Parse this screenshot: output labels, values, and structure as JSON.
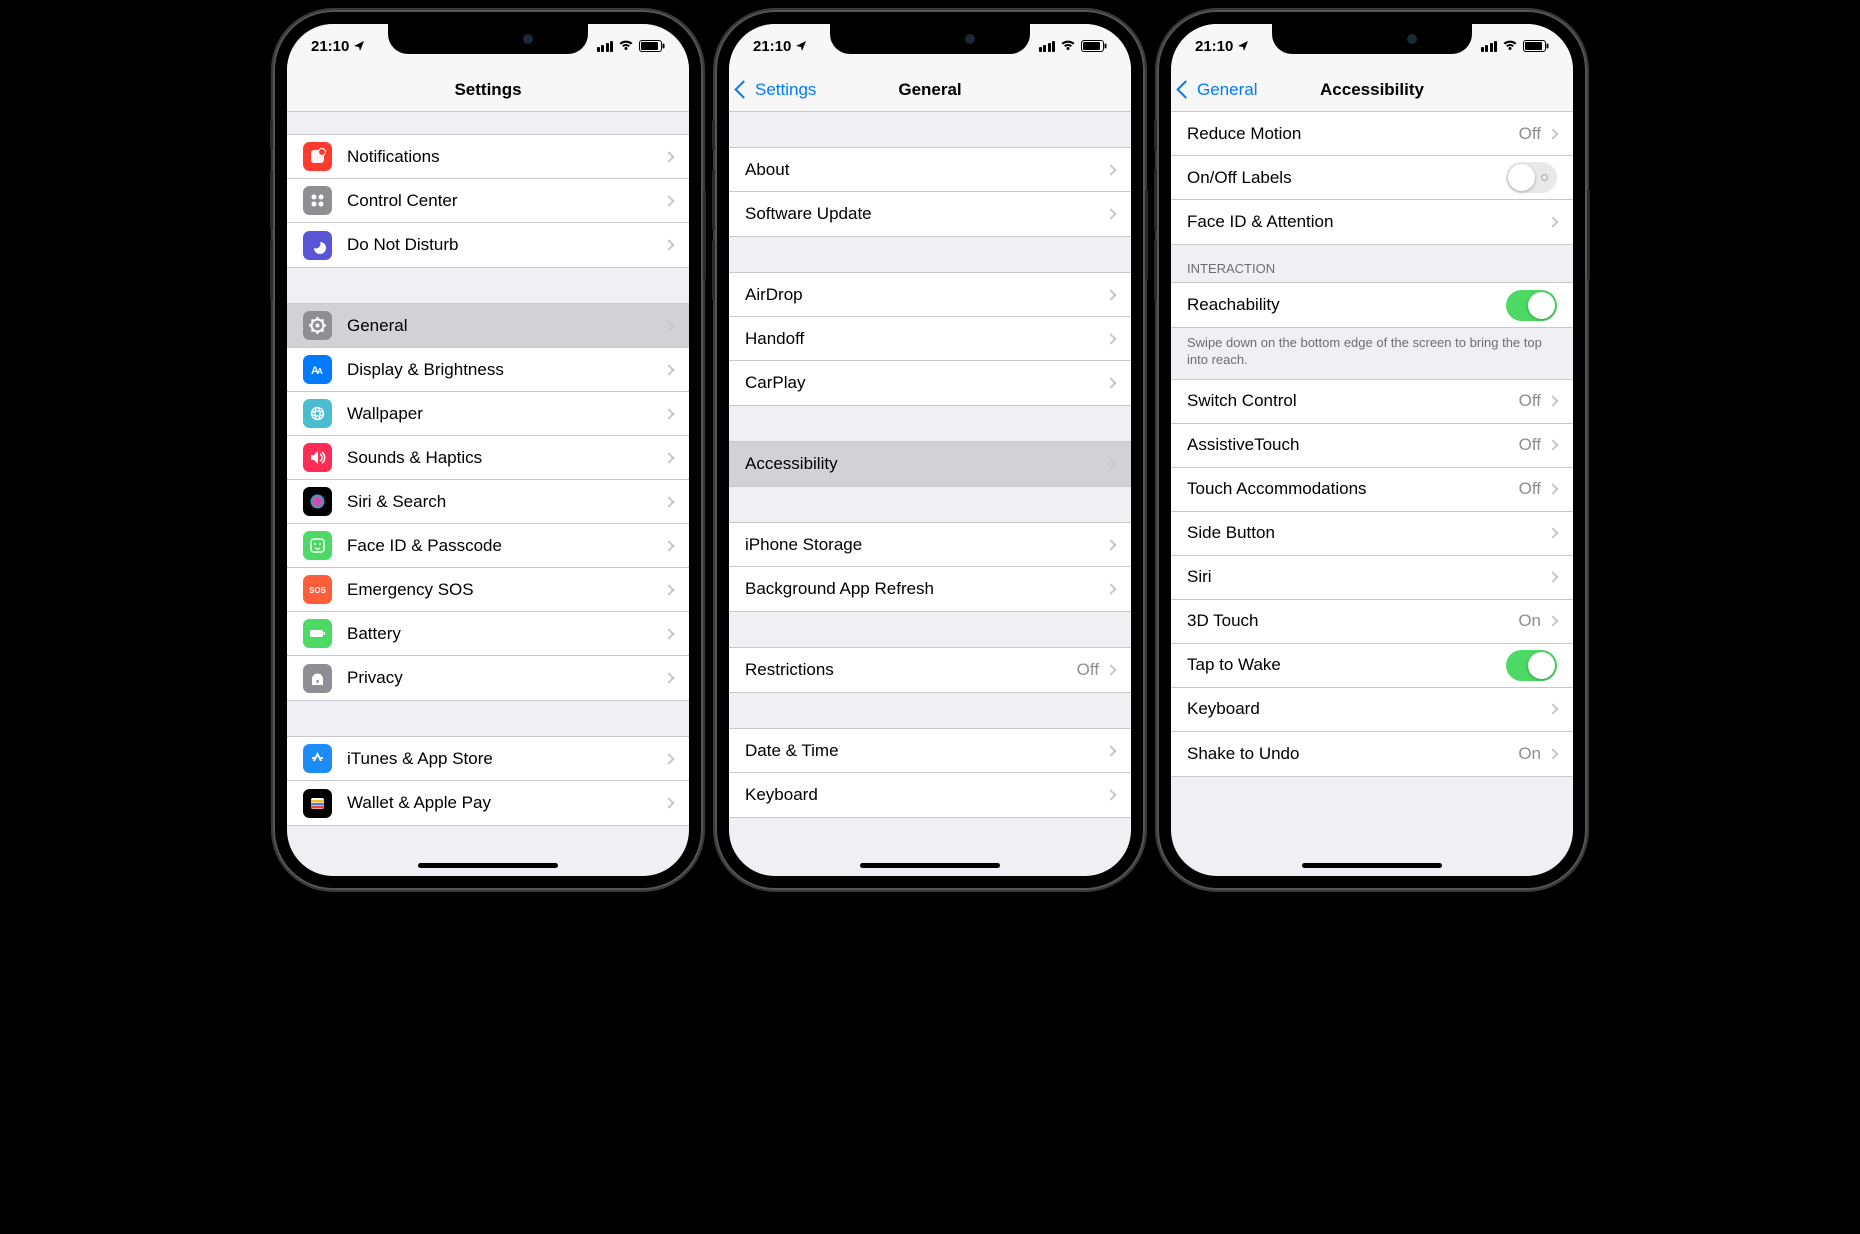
{
  "status": {
    "time": "21:10"
  },
  "phone1": {
    "title": "Settings",
    "items": [
      {
        "label": "Notifications",
        "icon": "notifications",
        "bg": "#ff3b30"
      },
      {
        "label": "Control Center",
        "icon": "control-center",
        "bg": "#8e8e93"
      },
      {
        "label": "Do Not Disturb",
        "icon": "dnd",
        "bg": "#5856d6"
      }
    ],
    "items2": [
      {
        "label": "General",
        "icon": "general",
        "bg": "#8e8e93",
        "selected": true
      },
      {
        "label": "Display & Brightness",
        "icon": "display",
        "bg": "#007aff"
      },
      {
        "label": "Wallpaper",
        "icon": "wallpaper",
        "bg": "#4bbdd1"
      },
      {
        "label": "Sounds & Haptics",
        "icon": "sounds",
        "bg": "#ff2d55"
      },
      {
        "label": "Siri & Search",
        "icon": "siri",
        "bg": "#000"
      },
      {
        "label": "Face ID & Passcode",
        "icon": "faceid",
        "bg": "#4cd964"
      },
      {
        "label": "Emergency SOS",
        "icon": "sos",
        "bg": "#ff5e3a"
      },
      {
        "label": "Battery",
        "icon": "battery",
        "bg": "#4cd964"
      },
      {
        "label": "Privacy",
        "icon": "privacy",
        "bg": "#8e8e93"
      }
    ],
    "items3": [
      {
        "label": "iTunes & App Store",
        "icon": "appstore",
        "bg": "#1e8cf7"
      },
      {
        "label": "Wallet & Apple Pay",
        "icon": "wallet",
        "bg": "#000"
      }
    ]
  },
  "phone2": {
    "back": "Settings",
    "title": "General",
    "g1": [
      {
        "label": "About"
      },
      {
        "label": "Software Update"
      }
    ],
    "g2": [
      {
        "label": "AirDrop"
      },
      {
        "label": "Handoff"
      },
      {
        "label": "CarPlay"
      }
    ],
    "g3": [
      {
        "label": "Accessibility",
        "selected": true
      }
    ],
    "g4": [
      {
        "label": "iPhone Storage"
      },
      {
        "label": "Background App Refresh"
      }
    ],
    "g5": [
      {
        "label": "Restrictions",
        "value": "Off"
      }
    ],
    "g6": [
      {
        "label": "Date & Time"
      },
      {
        "label": "Keyboard"
      }
    ]
  },
  "phone3": {
    "back": "General",
    "title": "Accessibility",
    "g0": [
      {
        "label": "Reduce Motion",
        "value": "Off",
        "type": "disclosure"
      },
      {
        "label": "On/Off Labels",
        "type": "toggle-labeled",
        "on": false
      },
      {
        "label": "Face ID & Attention",
        "type": "disclosure"
      }
    ],
    "section_header": "INTERACTION",
    "g1": [
      {
        "label": "Reachability",
        "type": "toggle",
        "on": true
      }
    ],
    "footer": "Swipe down on the bottom edge of the screen to bring the top into reach.",
    "g2": [
      {
        "label": "Switch Control",
        "value": "Off",
        "type": "disclosure"
      },
      {
        "label": "AssistiveTouch",
        "value": "Off",
        "type": "disclosure"
      },
      {
        "label": "Touch Accommodations",
        "value": "Off",
        "type": "disclosure"
      },
      {
        "label": "Side Button",
        "type": "disclosure"
      },
      {
        "label": "Siri",
        "type": "disclosure"
      },
      {
        "label": "3D Touch",
        "value": "On",
        "type": "disclosure"
      },
      {
        "label": "Tap to Wake",
        "type": "toggle",
        "on": true
      },
      {
        "label": "Keyboard",
        "type": "disclosure"
      },
      {
        "label": "Shake to Undo",
        "value": "On",
        "type": "disclosure"
      }
    ]
  }
}
